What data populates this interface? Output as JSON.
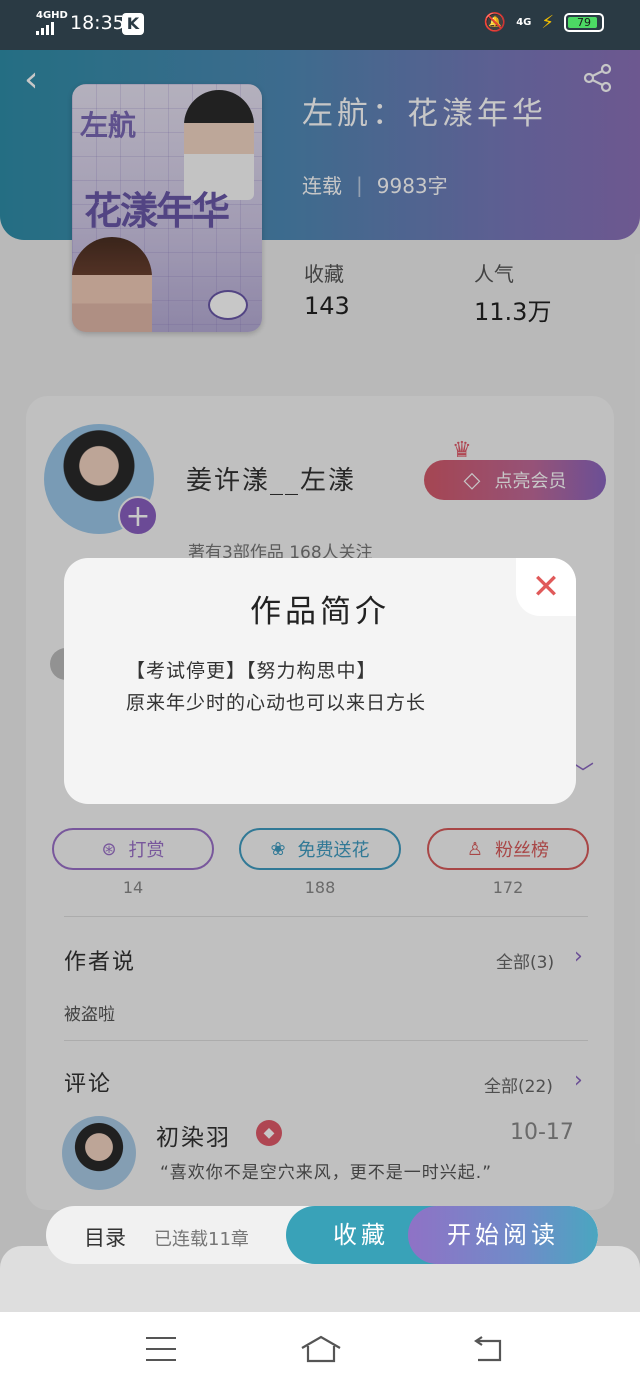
{
  "status_bar": {
    "network": "4GHD",
    "time": "18:35",
    "app_badge": "K",
    "network_right": "4G",
    "battery": "79"
  },
  "book": {
    "title": "左航：花漾年华",
    "status": "连载",
    "word_count": "9983字",
    "cover_title_line1": "左航",
    "cover_title_line2": "花漾年华"
  },
  "stats": {
    "favorites_label": "收藏",
    "favorites_value": "143",
    "popularity_label": "人气",
    "popularity_value": "11.3万"
  },
  "author": {
    "name": "姜许漾__左漾",
    "meta": "著有3部作品 168人关注",
    "vip_button": "点亮会员"
  },
  "modal": {
    "title": "作品简介",
    "line1": "【考试停更】【努力构思中】",
    "line2": "原来年少时的心动也可以来日方长"
  },
  "actions": {
    "tip": {
      "label": "打赏",
      "count": "14"
    },
    "flower": {
      "label": "免费送花",
      "count": "188"
    },
    "fans": {
      "label": "粉丝榜",
      "count": "172"
    }
  },
  "author_says": {
    "title": "作者说",
    "all": "全部(3)",
    "text": "被盗啦"
  },
  "comments": {
    "title": "评论",
    "all": "全部(22)",
    "first": {
      "user": "初染羽",
      "time": "10-17",
      "text": "“喜欢你不是空穴来风，更不是一时兴起.”"
    }
  },
  "bottom_bar": {
    "toc": "目录",
    "toc_count": "已连载11章",
    "collect": "收藏",
    "read": "开始阅读"
  },
  "colors": {
    "accent_purple": "#8a66c0",
    "accent_teal": "#39a2b8",
    "accent_red": "#d85a5a"
  }
}
